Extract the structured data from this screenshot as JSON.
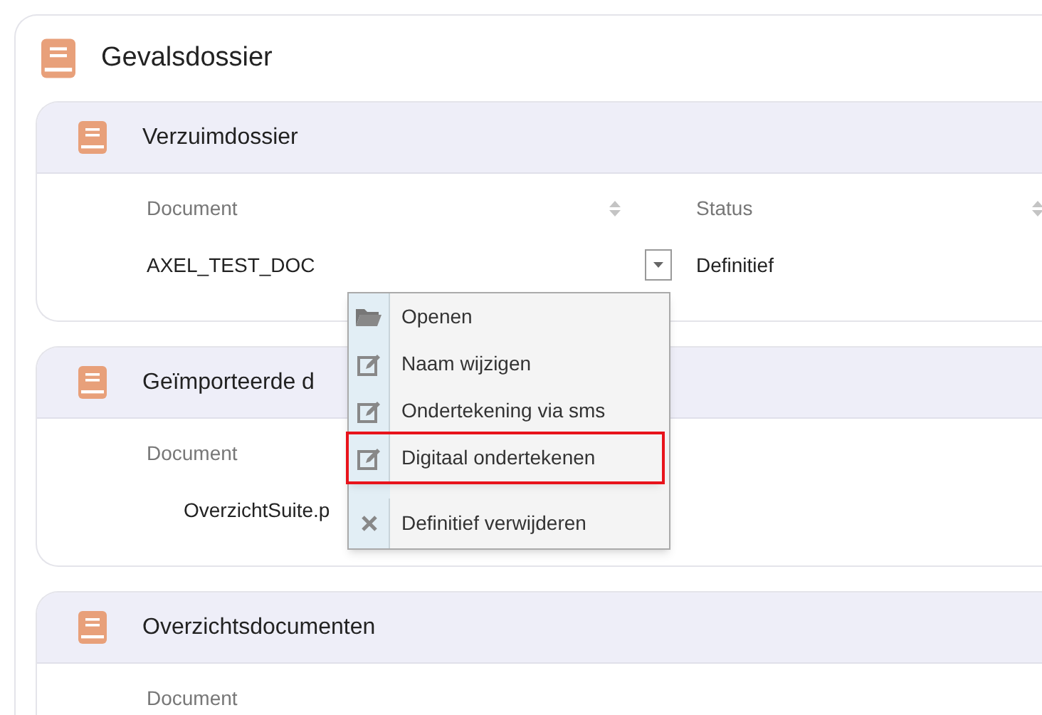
{
  "title": "Gevalsdossier",
  "sections": [
    {
      "title": "Verzuimdossier",
      "columns": [
        {
          "label": "Document",
          "sortable": true
        },
        {
          "label": "Status",
          "sortable": true
        }
      ],
      "rows": [
        {
          "cells": [
            "AXEL_TEST_DOC",
            "Definitief"
          ],
          "menu_button": true
        }
      ]
    },
    {
      "title": "Geïmporteerde d",
      "columns": [
        {
          "label": "Document"
        }
      ],
      "rows": [
        {
          "cells": [
            "OverzichtSuite.p"
          ]
        }
      ]
    },
    {
      "title": "Overzichtsdocumenten",
      "columns": [
        {
          "label": "Document",
          "sortable": false
        }
      ]
    }
  ],
  "context_menu": {
    "items": [
      {
        "label": "Openen",
        "kind": "folder",
        "highlighted": false
      },
      {
        "label": "Naam wijzigen",
        "kind": "edit",
        "highlighted": false
      },
      {
        "label": "Ondertekening via sms",
        "kind": "edit",
        "highlighted": false
      },
      {
        "label": "Digitaal ondertekenen",
        "kind": "edit",
        "highlighted": true
      },
      {
        "label": "Definitief verwijderen",
        "kind": "delete",
        "highlighted": false
      }
    ]
  }
}
